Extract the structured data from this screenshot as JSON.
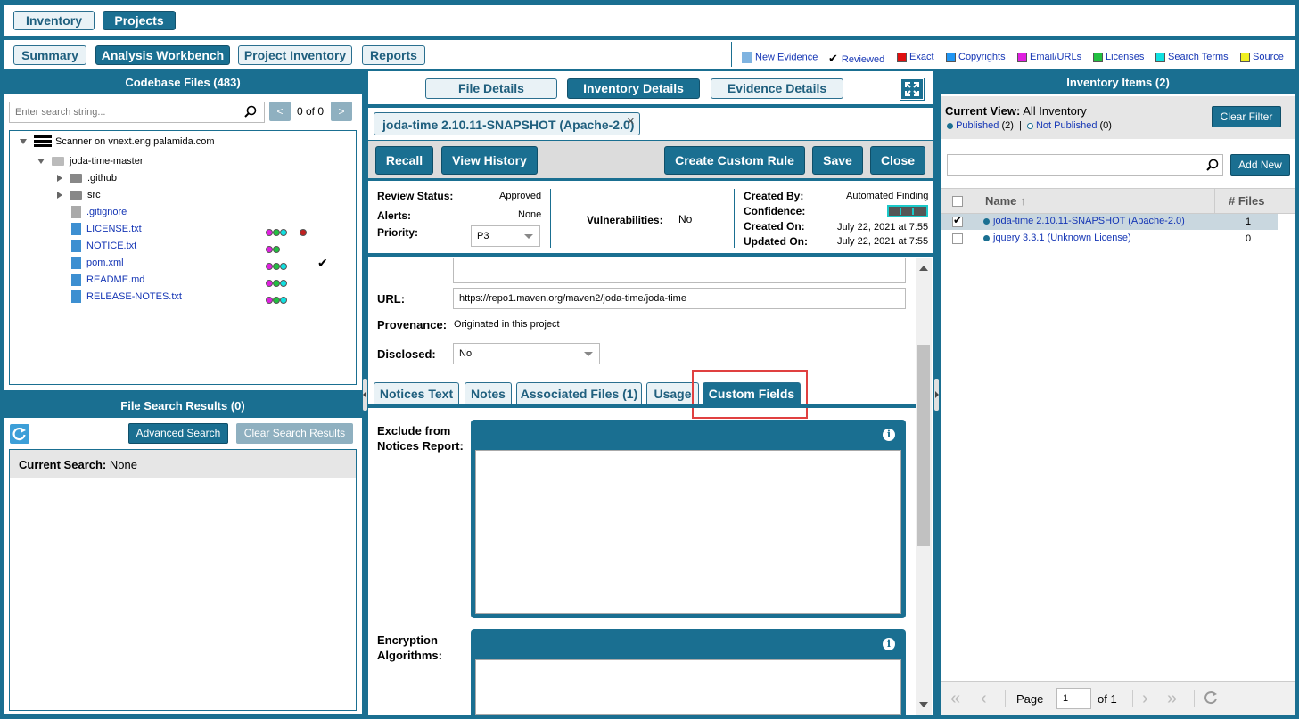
{
  "top_nav": {
    "inventory": "Inventory",
    "projects": "Projects"
  },
  "sub_nav": {
    "summary": "Summary",
    "workbench": "Analysis Workbench",
    "project_inventory": "Project Inventory",
    "reports": "Reports"
  },
  "legend": [
    {
      "label": "New Evidence",
      "icon": "file-icon"
    },
    {
      "label": "Reviewed",
      "icon": "check-icon"
    },
    {
      "label": "Exact",
      "color": "#e01010"
    },
    {
      "label": "Copyrights",
      "color": "#2196f3"
    },
    {
      "label": "Email/URLs",
      "color": "#e020e0"
    },
    {
      "label": "Licenses",
      "color": "#22c040"
    },
    {
      "label": "Search Terms",
      "color": "#10e0e0"
    },
    {
      "label": "Source",
      "color": "#f0f020"
    }
  ],
  "codebase": {
    "title": "Codebase Files (483)",
    "search_placeholder": "Enter search string...",
    "pager": "0 of 0",
    "prev": "<",
    "next": ">",
    "tree": [
      {
        "label": "Scanner on vnext.eng.palamida.com",
        "type": "server"
      },
      {
        "label": "joda-time-master",
        "type": "folder-open"
      },
      {
        "label": ".github",
        "type": "folder"
      },
      {
        "label": "src",
        "type": "folder"
      },
      {
        "label": ".gitignore",
        "type": "file-grey"
      },
      {
        "label": "LICENSE.txt",
        "type": "file",
        "dots": [
          "#e020e0",
          "#22c040",
          "#10e0e0",
          "#c02020"
        ]
      },
      {
        "label": "NOTICE.txt",
        "type": "file",
        "dots": [
          "#e020e0",
          "#22c040"
        ]
      },
      {
        "label": "pom.xml",
        "type": "file",
        "dots": [
          "#e020e0",
          "#22c040",
          "#10e0e0"
        ],
        "reviewed": "✔"
      },
      {
        "label": "README.md",
        "type": "file",
        "dots": [
          "#e020e0",
          "#22c040",
          "#10e0e0"
        ]
      },
      {
        "label": "RELEASE-NOTES.txt",
        "type": "file",
        "dots": [
          "#e020e0",
          "#22c040",
          "#10e0e0"
        ]
      }
    ]
  },
  "file_search": {
    "title": "File Search Results (0)",
    "advanced": "Advanced Search",
    "clear": "Clear Search Results",
    "current_label": "Current Search:",
    "current_value": "None"
  },
  "center": {
    "tabs": {
      "file_details": "File Details",
      "inventory_details": "Inventory Details",
      "evidence_details": "Evidence Details"
    },
    "doc_tab": "joda-time 2.10.11-SNAPSHOT (Apache-2.0)",
    "doc_tab_close": "×",
    "actions": {
      "recall": "Recall",
      "history": "View History",
      "custom_rule": "Create Custom Rule",
      "save": "Save",
      "close": "Close"
    },
    "review_status_label": "Review Status:",
    "review_status": "Approved",
    "alerts_label": "Alerts:",
    "alerts": "None",
    "priority_label": "Priority:",
    "priority": "P3",
    "vuln_label": "Vulnerabilities:",
    "vuln": "No",
    "created_by_label": "Created By:",
    "created_by": "Automated Finding",
    "confidence_label": "Confidence:",
    "created_on_label": "Created On:",
    "created_on": "July 22, 2021 at 7:55",
    "updated_on_label": "Updated On:",
    "updated_on": "July 22, 2021 at 7:55",
    "url_label": "URL:",
    "url": "https://repo1.maven.org/maven2/joda-time/joda-time",
    "provenance_label": "Provenance:",
    "provenance": "Originated in this project",
    "disclosed_label": "Disclosed:",
    "disclosed": "No",
    "detail_tabs": {
      "notices": "Notices Text",
      "notes": "Notes",
      "assoc": "Associated Files (1)",
      "usage": "Usage",
      "custom": "Custom Fields"
    },
    "exclude_label": "Exclude from Notices Report:",
    "encryption_label": "Encryption Algorithms:",
    "info": "i"
  },
  "inventory": {
    "title": "Inventory Items (2)",
    "view_label": "Current View:",
    "view_value": "All Inventory",
    "published": "Published",
    "published_count": "(2)",
    "separator": "|",
    "not_published": "Not Published",
    "not_published_count": "(0)",
    "clear_filter": "Clear Filter",
    "add_new": "Add New",
    "col_name": "Name",
    "sort_arrow": "↑",
    "col_files": "# Files",
    "rows": [
      {
        "name": "joda-time 2.10.11-SNAPSHOT (Apache-2.0)",
        "files": "1",
        "checked": true
      },
      {
        "name": "jquery 3.3.1 (Unknown License)",
        "files": "0",
        "checked": false
      }
    ],
    "page_label": "Page",
    "page": "1",
    "of": "of 1"
  }
}
